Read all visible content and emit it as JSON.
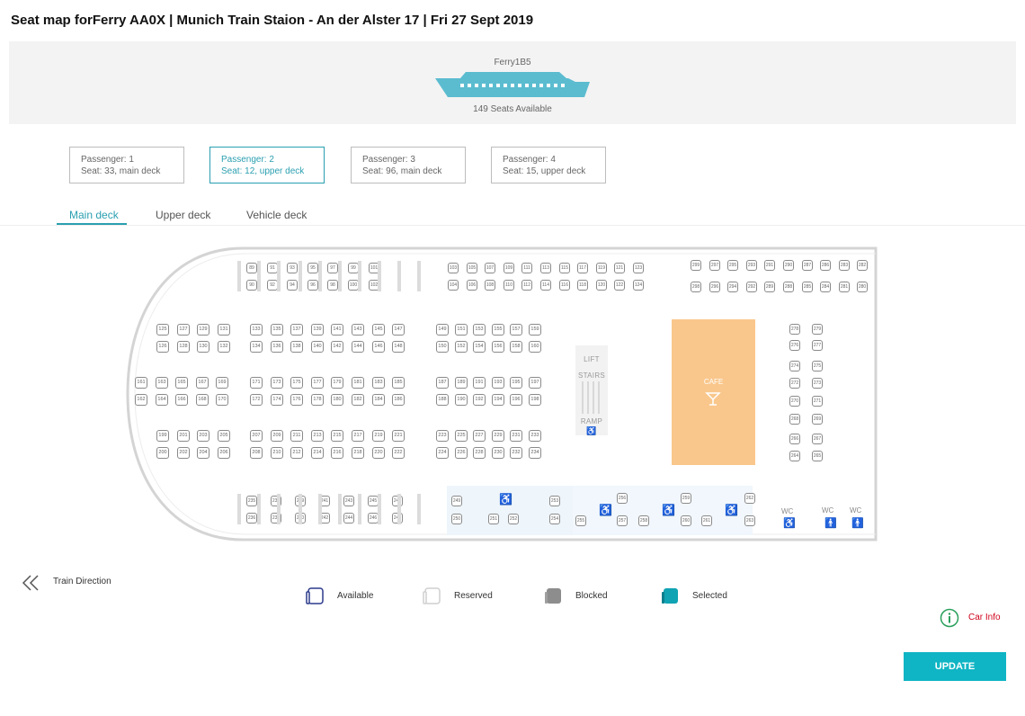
{
  "header": {
    "title": "Seat map forFerry AA0X | Munich Train Staion - An der Alster 17 | Fri 27 Sept 2019"
  },
  "banner": {
    "ferry_name": "Ferry1B5",
    "seats_available": "149 Seats Available",
    "ship_color": "#5bbcd0"
  },
  "passengers": [
    {
      "label": "Passenger: 1",
      "seat": "Seat: 33, main deck",
      "selected": false
    },
    {
      "label": "Passenger: 2",
      "seat": "Seat: 12, upper deck",
      "selected": true
    },
    {
      "label": "Passenger: 3",
      "seat": "Seat: 96, main deck",
      "selected": false
    },
    {
      "label": "Passenger: 4",
      "seat": "Seat: 15, upper deck",
      "selected": false
    }
  ],
  "tabs": [
    {
      "label": "Main deck",
      "active": true
    },
    {
      "label": "Upper deck",
      "active": false
    },
    {
      "label": "Vehicle deck",
      "active": false
    }
  ],
  "deck": {
    "lift_label": "LIFT",
    "stairs_label": "STAIRS",
    "ramp_label": "RAMP",
    "cafe_label": "CAFE",
    "wc_label": "WC",
    "seat_groups": [
      {
        "name": "row-a-top",
        "seats": [
          "89",
          "91",
          "93",
          "95",
          "97",
          "99",
          "101"
        ]
      },
      {
        "name": "row-a-bottom",
        "seats": [
          "90",
          "92",
          "94",
          "96",
          "98",
          "100",
          "102"
        ]
      },
      {
        "name": "row-b-top",
        "seats": [
          "103",
          "105",
          "107",
          "109",
          "111",
          "113",
          "115",
          "117",
          "119",
          "121",
          "123"
        ]
      },
      {
        "name": "row-b-bottom",
        "seats": [
          "104",
          "106",
          "108",
          "110",
          "112",
          "114",
          "116",
          "118",
          "120",
          "122",
          "124"
        ]
      },
      {
        "name": "row-c-top",
        "seats": [
          "299",
          "297",
          "295",
          "293",
          "291",
          "290",
          "287",
          "286",
          "283",
          "282"
        ]
      },
      {
        "name": "row-c-bottom",
        "seats": [
          "298",
          "296",
          "294",
          "292",
          "289",
          "288",
          "285",
          "284",
          "281",
          "280"
        ]
      },
      {
        "name": "block1-r1",
        "seats": [
          "125",
          "127",
          "129",
          "131"
        ]
      },
      {
        "name": "block1-r2",
        "seats": [
          "126",
          "128",
          "130",
          "132"
        ]
      },
      {
        "name": "block2-r1",
        "seats": [
          "133",
          "135",
          "137",
          "139",
          "141",
          "143",
          "145",
          "147"
        ]
      },
      {
        "name": "block2-r2",
        "seats": [
          "134",
          "136",
          "138",
          "140",
          "142",
          "144",
          "146",
          "148"
        ]
      },
      {
        "name": "block3-r1",
        "seats": [
          "149",
          "151",
          "153",
          "155",
          "157",
          "159"
        ]
      },
      {
        "name": "block3-r2",
        "seats": [
          "150",
          "152",
          "154",
          "156",
          "158",
          "160"
        ]
      },
      {
        "name": "block4-r1",
        "seats": [
          "161",
          "163",
          "165",
          "167",
          "169"
        ]
      },
      {
        "name": "block4-r2",
        "seats": [
          "162",
          "164",
          "166",
          "168",
          "170"
        ]
      },
      {
        "name": "block5-r1",
        "seats": [
          "171",
          "173",
          "175",
          "177",
          "179",
          "181",
          "183",
          "185"
        ]
      },
      {
        "name": "block5-r2",
        "seats": [
          "172",
          "174",
          "176",
          "178",
          "180",
          "182",
          "184",
          "186"
        ]
      },
      {
        "name": "block6-r1",
        "seats": [
          "187",
          "189",
          "191",
          "193",
          "195",
          "197"
        ]
      },
      {
        "name": "block6-r2",
        "seats": [
          "188",
          "190",
          "192",
          "194",
          "196",
          "198"
        ]
      },
      {
        "name": "block7-r1",
        "seats": [
          "199",
          "201",
          "203",
          "205"
        ]
      },
      {
        "name": "block7-r2",
        "seats": [
          "200",
          "202",
          "204",
          "206"
        ]
      },
      {
        "name": "block8-r1",
        "seats": [
          "207",
          "209",
          "211",
          "213",
          "215",
          "217",
          "219",
          "221"
        ]
      },
      {
        "name": "block8-r2",
        "seats": [
          "208",
          "210",
          "212",
          "214",
          "216",
          "218",
          "220",
          "222"
        ]
      },
      {
        "name": "block9-r1",
        "seats": [
          "223",
          "225",
          "227",
          "229",
          "231",
          "233"
        ]
      },
      {
        "name": "block9-r2",
        "seats": [
          "224",
          "226",
          "228",
          "230",
          "232",
          "234"
        ]
      },
      {
        "name": "bottom-r1",
        "seats": [
          "235",
          "237",
          "239",
          "241",
          "243",
          "245",
          "247"
        ]
      },
      {
        "name": "bottom-r2",
        "seats": [
          "236",
          "238",
          "240",
          "242",
          "244",
          "246",
          "248"
        ]
      },
      {
        "name": "right-col",
        "seats": [
          "278",
          "279",
          "276",
          "277",
          "274",
          "275",
          "272",
          "273",
          "270",
          "271",
          "268",
          "269",
          "266",
          "267",
          "264",
          "265"
        ]
      },
      {
        "name": "accessible",
        "seats": [
          "249",
          "250",
          "251",
          "252",
          "253",
          "254",
          "255",
          "256",
          "257",
          "258",
          "259",
          "260",
          "261",
          "262",
          "263"
        ]
      }
    ]
  },
  "legend": {
    "available": "Available",
    "reserved": "Reserved",
    "blocked": "Blocked",
    "selected": "Selected",
    "colors": {
      "available": "#2b3a8c",
      "reserved": "#cfcfcf",
      "blocked": "#8d8d8d",
      "selected": "#0fa3b3"
    }
  },
  "train_direction": "Train Direction",
  "car_info": "Car Info",
  "update_button": "UPDATE"
}
